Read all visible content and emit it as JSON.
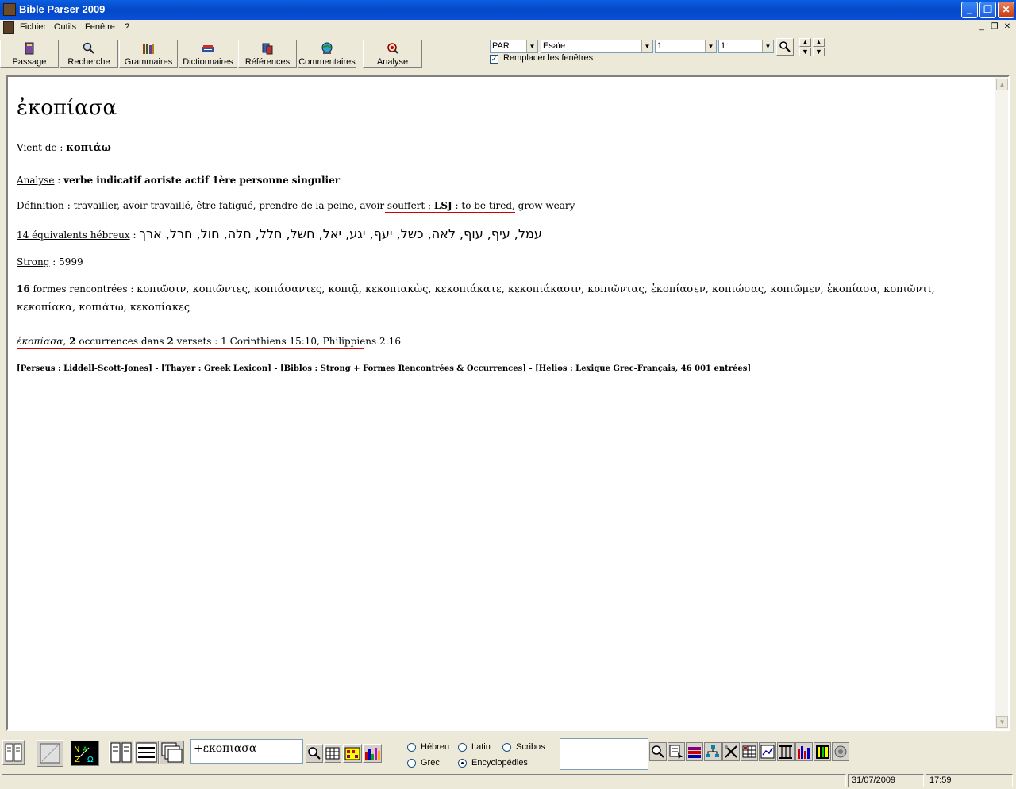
{
  "window": {
    "title": "Bible Parser 2009"
  },
  "menu": {
    "items": [
      "Fichier",
      "Outils",
      "Fenêtre",
      "?"
    ]
  },
  "toolbar": {
    "buttons": [
      {
        "label": "Passage",
        "icon": "book-icon"
      },
      {
        "label": "Recherche",
        "icon": "search-icon"
      },
      {
        "label": "Grammaires",
        "icon": "books-icon"
      },
      {
        "label": "Dictionnaires",
        "icon": "dictionary-icon"
      },
      {
        "label": "Références",
        "icon": "references-icon"
      },
      {
        "label": "Commentaires",
        "icon": "globe-icon"
      },
      {
        "label": "Analyse",
        "icon": "analyze-icon"
      }
    ],
    "version_select": "PAR",
    "book_select": "Esaïe",
    "chapter_select": "1",
    "verse_select": "1",
    "replace_windows_label": "Remplacer les fenêtres",
    "replace_windows_checked": true
  },
  "entry": {
    "headword": "ἐκοπίασα",
    "from_label": "Vient de",
    "from_value": "κοπιάω",
    "analysis_label": "Analyse",
    "analysis_value": "verbe indicatif aoriste actif 1ère personne singulier",
    "definition_label": "Définition",
    "definition_value": "travailler, avoir travaillé, être fatigué, prendre de la peine, avoir souffert ;",
    "lsj_label": "LSJ",
    "lsj_value": ": to be tired, grow weary",
    "hebrew_label": "14 équivalents hébreux",
    "hebrew_value": "עמל, עיף, עוף, לאה, כשל, יעף, יגע, יאל, חשל, חלל, חלה, חול, חרל, ארך",
    "strong_label": "Strong",
    "strong_value": "5999",
    "forms_count": "16",
    "forms_label": "formes rencontrées",
    "forms_value": "κοπιῶσιν, κοπιῶντες, κοπιάσαντες, κοπιᾷ, κεκοπιακὼς, κεκοπιάκατε, κεκοπιάκασιν, κοπιῶντας, ἐκοπίασεν, κοπιώσας, κοπιῶμεν, ἐκοπίασα, κοπιῶντι, κεκοπίακα, κοπιάτω, κεκοπίακες",
    "occ_word": "ἐκοπίασα",
    "occ_count": "2",
    "occ_mid": "occurrences dans",
    "occ_verses": "2",
    "occ_tail": "versets : 1 Corinthiens 15:10, Philippiens 2:16",
    "sources": "[Perseus : Liddell-Scott-Jones] - [Thayer : Greek Lexicon] - [Biblos : Strong + Formes Rencontrées & Occurrences] - [Helios : Lexique Grec-Français, 46 001 entrées]"
  },
  "bottom": {
    "search_value": "+εκοπιασα",
    "radios": [
      {
        "label": "Hébreu",
        "checked": false
      },
      {
        "label": "Latin",
        "checked": false
      },
      {
        "label": "Scribos",
        "checked": false
      },
      {
        "label": "Grec",
        "checked": false
      },
      {
        "label": "Encyclopédies",
        "checked": true
      }
    ]
  },
  "status": {
    "date": "31/07/2009",
    "time": "17:59"
  }
}
